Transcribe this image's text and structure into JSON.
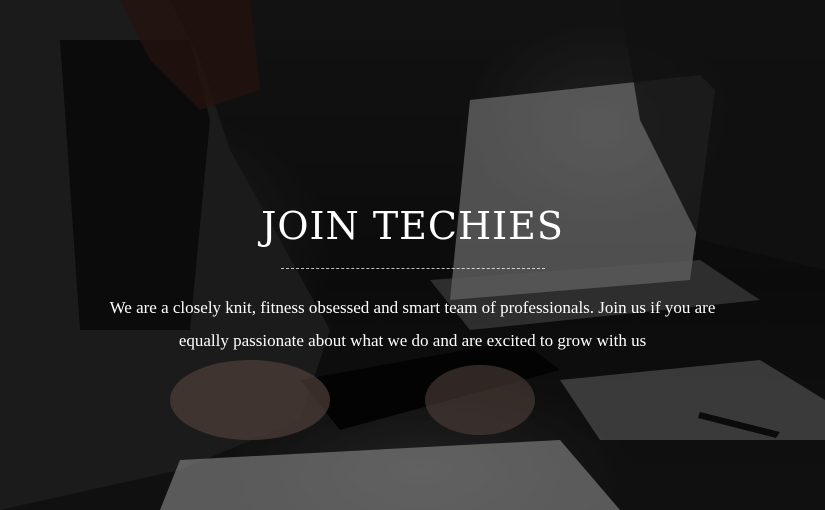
{
  "hero": {
    "title": "JOIN TECHIES",
    "description": "We are a closely knit, fitness obsessed and smart team of professionals. Join us if you are equally passionate about what we do and are excited to grow with us"
  },
  "colors": {
    "overlay": "#000000",
    "text": "#ffffff"
  }
}
